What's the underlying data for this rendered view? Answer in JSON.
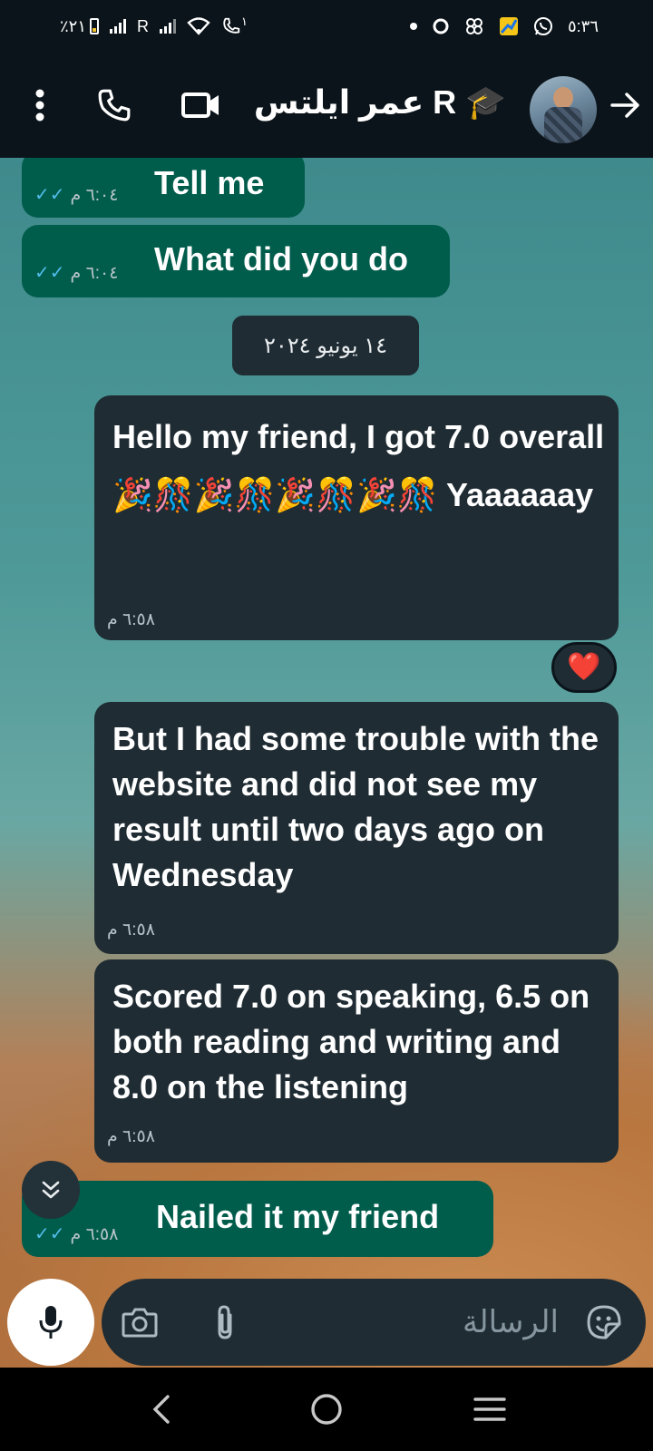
{
  "status_bar": {
    "battery_text": "٪٢١",
    "carrier_label": "R",
    "call_badge": "١",
    "time": "٥:٣٦"
  },
  "app_bar": {
    "contact_name": "عمر ايلتس R 🎓"
  },
  "messages": [
    {
      "text": "Tell me",
      "time": "٦:٠٤ م"
    },
    {
      "text": "What did you do",
      "time": "٦:٠٤ م"
    },
    {
      "date": "١٤ يونيو ٢٠٢٤"
    },
    {
      "text": "Hello my friend, I got 7.0 overall 🎉🎊🎉🎊🎉🎊🎉🎊 Yaaaaaay",
      "time": "٦:٥٨ م",
      "reaction": "❤️"
    },
    {
      "text": "But I had some trouble with the website and did not see my result until two days ago on Wednesday",
      "time": "٦:٥٨ م"
    },
    {
      "text": "Scored 7.0 on speaking, 6.5 on both reading and writing and 8.0 on the listening",
      "time": "٦:٥٨ م"
    },
    {
      "text": "Nailed it my friend",
      "time": "٦:٥٨ م"
    }
  ],
  "composer": {
    "placeholder": "الرسالة"
  },
  "colors": {
    "outgoing_bubble": "#005c4b",
    "incoming_bubble": "#1f2c33",
    "read_ticks": "#53bdeb",
    "app_bar": "#0b141a"
  }
}
